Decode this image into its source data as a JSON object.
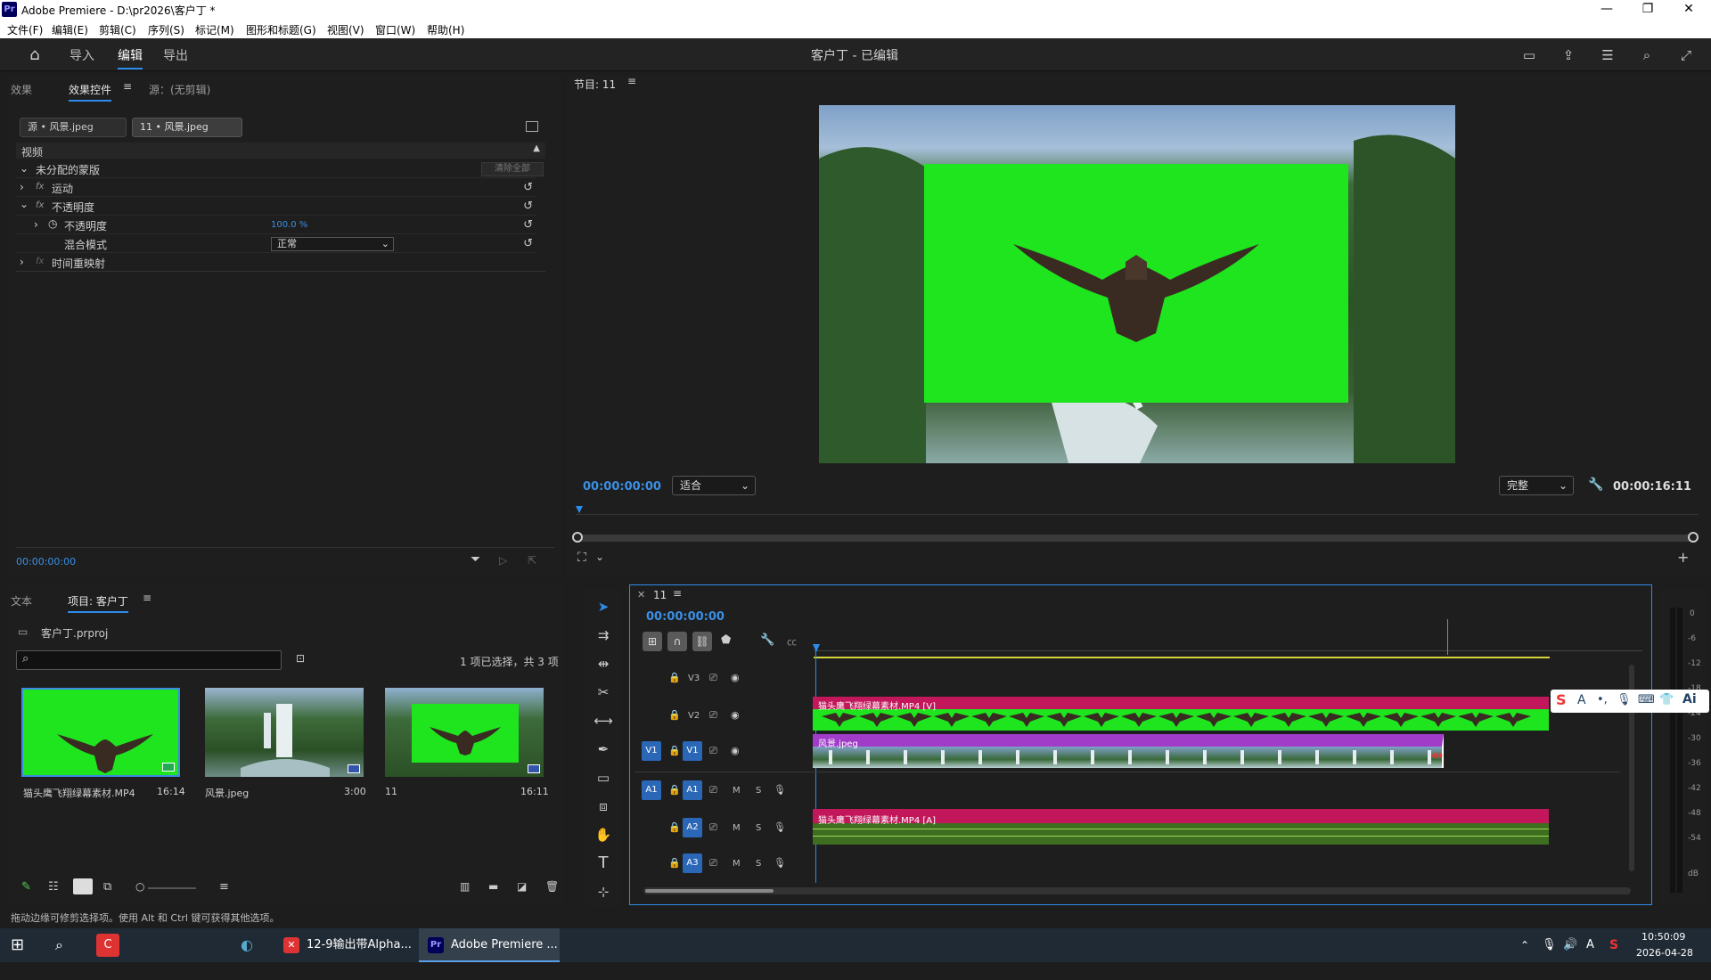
{
  "window": {
    "title": "Adobe Premiere - D:\\pr2026\\客户丁 *",
    "app_badge": "Pr",
    "controls": [
      "—",
      "❐",
      "✕"
    ]
  },
  "menu": [
    "文件(F)",
    "编辑(E)",
    "剪辑(C)",
    "序列(S)",
    "标记(M)",
    "图形和标题(G)",
    "视图(V)",
    "窗口(W)",
    "帮助(H)"
  ],
  "workspace": {
    "tabs": [
      {
        "label": "导入",
        "active": false
      },
      {
        "label": "编辑",
        "active": true
      },
      {
        "label": "导出",
        "active": false
      }
    ],
    "project_title": "客户丁 - 已编辑"
  },
  "effect_panel": {
    "tabs": [
      "效果",
      "效果控件",
      "源：(无剪辑)"
    ],
    "menu_glyph": "≡",
    "source_chip": "源 • 风景.jpeg",
    "seq_chip": "11 • 风景.jpeg",
    "section": "视频",
    "rows": {
      "mask": "未分配的蒙版",
      "clear_all": "清除全部",
      "motion": "运动",
      "opacity": "不透明度",
      "opacity_prop": "不透明度",
      "opacity_value": "100.0 %",
      "blend_mode": "混合模式",
      "blend_value": "正常",
      "time_remap": "时间重映射",
      "fx": "fx"
    },
    "timecode": "00:00:00:00"
  },
  "program": {
    "label": "节目: 11",
    "timecode_left": "00:00:00:00",
    "fit": "适合",
    "quality": "完整",
    "timecode_right": "00:00:16:11"
  },
  "project_panel": {
    "tabs": [
      "文本",
      "项目: 客户丁"
    ],
    "file": "客户丁.prproj",
    "search_placeholder": "",
    "selection_info": "1 项已选择，共 3 项",
    "items": [
      {
        "name": "猫头鹰飞翔绿幕素材.MP4",
        "duration": "16:14"
      },
      {
        "name": "风景.jpeg",
        "duration": "3:00"
      },
      {
        "name": "11",
        "duration": "16:11"
      }
    ]
  },
  "timeline": {
    "seq_tab": "11",
    "menu_glyph": "≡",
    "timecode": "00:00:00:00",
    "tracks": {
      "v3": "V3",
      "v2": "V2",
      "v1": "V1",
      "v1_src": "V1",
      "a1": "A1",
      "a1_src": "A1",
      "a2": "A2",
      "a3": "A3",
      "mute": "M",
      "solo": "S"
    },
    "clips": {
      "v2": "猫头鹰飞翔绿幕素材.MP4 [V]",
      "v1": "风景.jpeg",
      "a2": "猫头鹰飞翔绿幕素材.MP4 [A]"
    },
    "meter_labels": [
      "0",
      "-6",
      "-12",
      "-18",
      "-24",
      "-30",
      "-36",
      "-42",
      "-48",
      "-54",
      "dB"
    ]
  },
  "status_bar": "拖动边缘可修剪选择项。使用 Alt 和 Ctrl 键可获得其他选项。",
  "taskbar": {
    "apps": [
      "12-9输出带Alpha...",
      "Adobe Premiere ..."
    ],
    "time": "10:50:09",
    "date": "2026-04-28"
  },
  "colors": {
    "accent_blue": "#2d8ceb",
    "clip_pink": "#c2185b",
    "clip_purple": "#a03cc8",
    "chroma_green": "#1fe51f"
  }
}
